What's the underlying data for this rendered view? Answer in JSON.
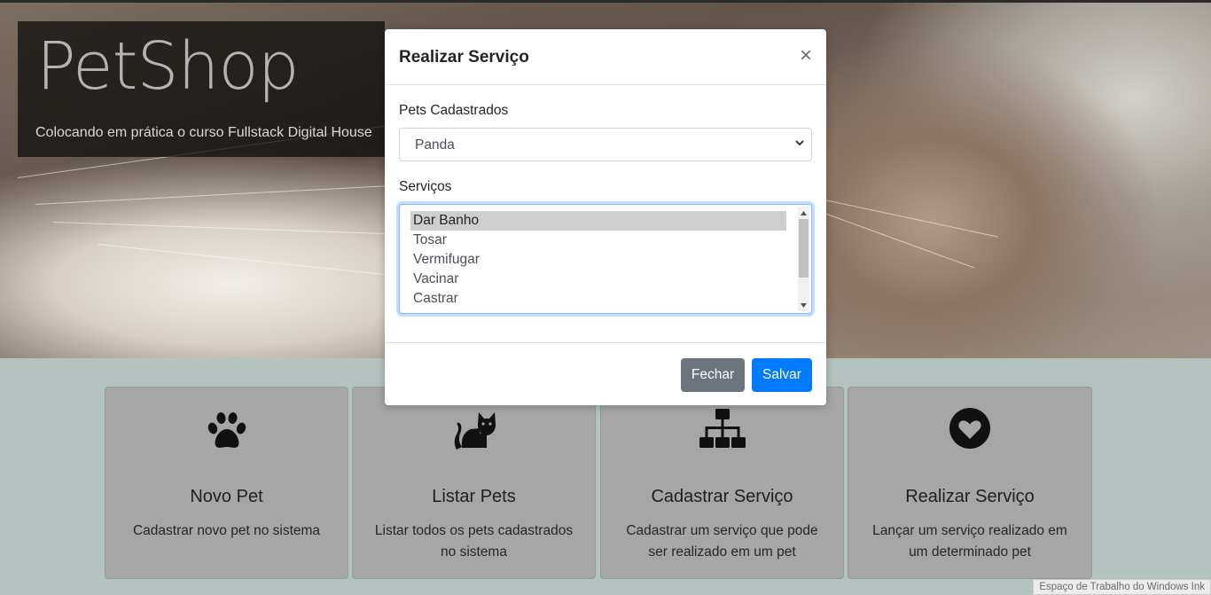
{
  "hero": {
    "title": "PetShop",
    "subtitle": "Colocando em prática o curso Fullstack Digital House"
  },
  "cards": [
    {
      "icon": "paw-icon",
      "title": "Novo Pet",
      "text": "Cadastrar novo pet no sistema"
    },
    {
      "icon": "cat-icon",
      "title": "Listar Pets",
      "text": "Listar todos os pets cadastrados no sistema"
    },
    {
      "icon": "sitemap-icon",
      "title": "Cadastrar Serviço",
      "text": "Cadastrar um serviço que pode ser realizado em um pet"
    },
    {
      "icon": "heart-circle-icon",
      "title": "Realizar Serviço",
      "text": "Lançar um serviço realizado em um determinado pet"
    }
  ],
  "modal": {
    "title": "Realizar Serviço",
    "close_label": "×",
    "pets_label": "Pets Cadastrados",
    "pets_selected": "Panda",
    "services_label": "Serviços",
    "services": [
      "Dar Banho",
      "Tosar",
      "Vermifugar",
      "Vacinar",
      "Castrar"
    ],
    "services_selected": "Dar Banho",
    "close_button": "Fechar",
    "save_button": "Salvar"
  },
  "watermark": "Espaço de Trabalho do Windows Ink",
  "colors": {
    "primary": "#007bff",
    "secondary": "#6c757d",
    "focus_border": "#80bdff"
  }
}
